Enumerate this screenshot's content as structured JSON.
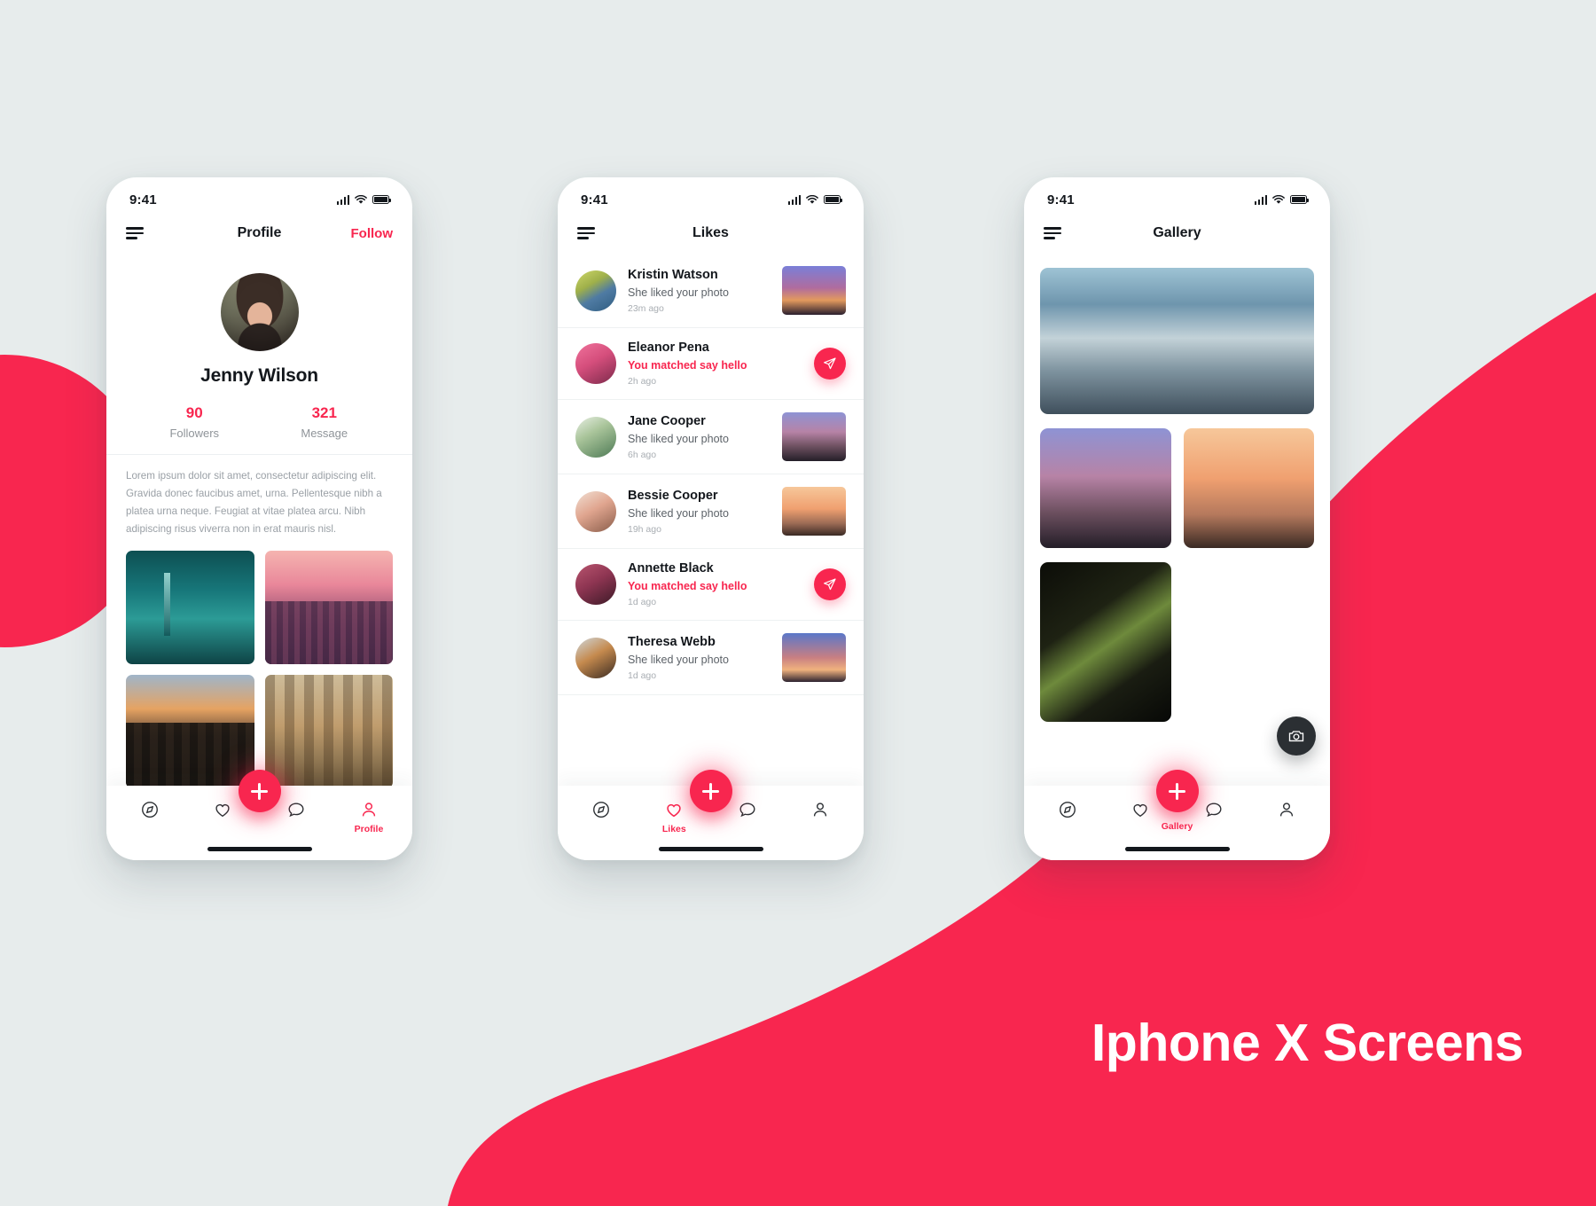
{
  "headline": "Iphone X Screens",
  "colors": {
    "accent": "#f8264f",
    "background": "#e7ecec",
    "text": "#13171c",
    "muted": "#8f9499"
  },
  "status_bar": {
    "time": "9:41",
    "icons": [
      "cellular-signal-icon",
      "wifi-icon",
      "battery-icon"
    ]
  },
  "screens": [
    {
      "id": "profile",
      "appbar": {
        "menu_icon": "hamburger-menu-icon",
        "title": "Profile",
        "action_label": "Follow"
      },
      "profile": {
        "name": "Jenny Wilson",
        "stats": [
          {
            "value": "90",
            "label": "Followers"
          },
          {
            "value": "321",
            "label": "Message"
          }
        ],
        "bio": "Lorem ipsum dolor sit amet, consectetur adipiscing elit. Gravida donec faucibus amet, urna. Pellentesque nibh a platea urna neque. Feugiat at vitae platea arcu. Nibh adipiscing risus viverra non in erat mauris nisl.",
        "photos": [
          "neon-street-photo",
          "pink-city-photo",
          "dusk-skyline-photo",
          "bridge-sunset-photo"
        ]
      },
      "tabbar": {
        "items": [
          {
            "icon": "compass-icon",
            "label": "",
            "active": false
          },
          {
            "icon": "heart-icon",
            "label": "",
            "active": false
          },
          {
            "icon": "chat-bubble-icon",
            "label": "",
            "active": false
          },
          {
            "icon": "person-icon",
            "label": "Profile",
            "active": true
          }
        ],
        "fab": "add-plus-button"
      }
    },
    {
      "id": "likes",
      "appbar": {
        "menu_icon": "hamburger-menu-icon",
        "title": "Likes",
        "action_label": ""
      },
      "list": [
        {
          "name": "Kristin Watson",
          "subtitle": "She liked your photo",
          "time": "23m ago",
          "matched": false,
          "trailing": "photo-thumbnail"
        },
        {
          "name": "Eleanor Pena",
          "subtitle": "You matched say hello",
          "time": "2h ago",
          "matched": true,
          "trailing": "send-message-button"
        },
        {
          "name": "Jane Cooper",
          "subtitle": "She liked your photo",
          "time": "6h ago",
          "matched": false,
          "trailing": "photo-thumbnail"
        },
        {
          "name": "Bessie Cooper",
          "subtitle": "She liked your photo",
          "time": "19h ago",
          "matched": false,
          "trailing": "photo-thumbnail"
        },
        {
          "name": "Annette Black",
          "subtitle": "You matched say hello",
          "time": "1d ago",
          "matched": true,
          "trailing": "send-message-button"
        },
        {
          "name": "Theresa Webb",
          "subtitle": "She liked your photo",
          "time": "1d ago",
          "matched": false,
          "trailing": "photo-thumbnail"
        }
      ],
      "tabbar": {
        "items": [
          {
            "icon": "compass-icon",
            "label": "",
            "active": false
          },
          {
            "icon": "heart-icon",
            "label": "Likes",
            "active": true
          },
          {
            "icon": "chat-bubble-icon",
            "label": "",
            "active": false
          },
          {
            "icon": "person-icon",
            "label": "",
            "active": false
          }
        ],
        "fab": "add-plus-button"
      }
    },
    {
      "id": "gallery",
      "appbar": {
        "menu_icon": "hamburger-menu-icon",
        "title": "Gallery",
        "action_label": ""
      },
      "gallery": {
        "items": [
          "clouds-sky-photo",
          "pink-dusk-poles-photo",
          "palm-tree-beach-photo",
          "green-window-photo"
        ],
        "camera_button": "camera-icon"
      },
      "tabbar": {
        "items": [
          {
            "icon": "compass-icon",
            "label": "",
            "active": false
          },
          {
            "icon": "heart-icon",
            "label": "",
            "active": false
          },
          {
            "icon": "chat-bubble-icon",
            "label": "",
            "active": false
          },
          {
            "icon": "person-icon",
            "label": "",
            "active": false
          }
        ],
        "fab_label": "Gallery",
        "fab": "add-plus-button"
      }
    }
  ]
}
